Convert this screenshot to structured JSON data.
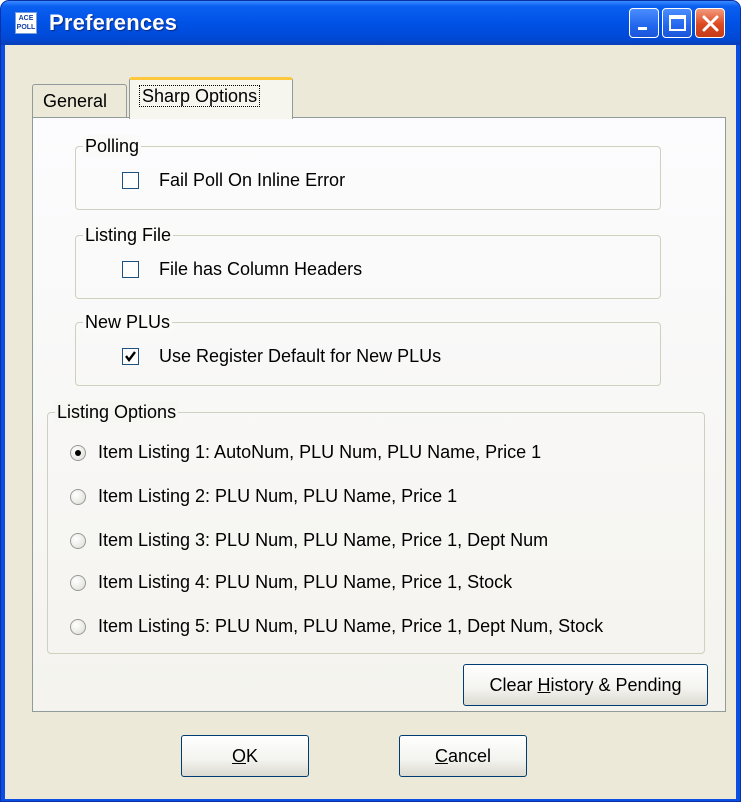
{
  "window": {
    "title": "Preferences",
    "app_icon_text": "ACE\nPOLL",
    "controls": {
      "minimize": "minimize-icon",
      "maximize": "maximize-icon",
      "close": "close-icon"
    }
  },
  "tabs": [
    {
      "label": "General",
      "active": false
    },
    {
      "label": "Sharp Options",
      "active": true
    }
  ],
  "groups": {
    "polling": {
      "label": "Polling",
      "checkbox": {
        "label": "Fail Poll On Inline Error",
        "checked": false
      }
    },
    "listing_file": {
      "label": "Listing File",
      "checkbox": {
        "label": "File has Column Headers",
        "checked": false
      }
    },
    "new_plus": {
      "label": "New PLUs",
      "checkbox": {
        "label": "Use Register Default for New PLUs",
        "checked": true
      }
    },
    "listing_options": {
      "label": "Listing Options",
      "options": [
        {
          "label": "Item Listing 1: AutoNum, PLU Num, PLU Name, Price 1",
          "selected": true
        },
        {
          "label": "Item Listing 2: PLU Num, PLU Name, Price 1",
          "selected": false
        },
        {
          "label": "Item Listing 3: PLU Num, PLU Name, Price 1, Dept Num",
          "selected": false
        },
        {
          "label": "Item Listing 4: PLU Num, PLU Name, Price 1, Stock",
          "selected": false
        },
        {
          "label": "Item Listing 5: PLU Num, PLU Name, Price 1, Dept Num, Stock",
          "selected": false
        }
      ]
    }
  },
  "buttons": {
    "clear_pre": "Clear ",
    "clear_u": "H",
    "clear_post": "istory & Pending",
    "ok_u": "O",
    "ok_post": "K",
    "cancel_u": "C",
    "cancel_post": "ancel"
  },
  "colors": {
    "titlebar": "#0a5ff0",
    "face": "#ece9d8",
    "tab_highlight": "#ffc83c",
    "close": "#dc4a22"
  }
}
